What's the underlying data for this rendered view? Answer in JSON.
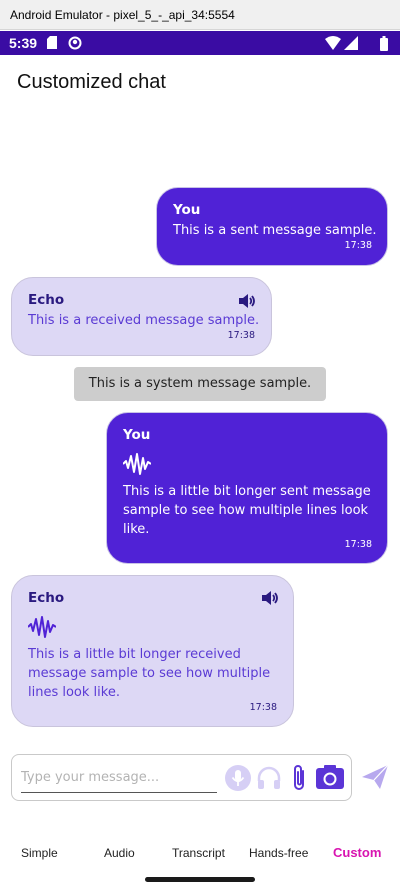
{
  "window": {
    "title": "Android Emulator - pixel_5_-_api_34:5554"
  },
  "status_bar": {
    "time": "5:39"
  },
  "page": {
    "title": "Customized chat"
  },
  "messages": [
    {
      "kind": "sent",
      "sender": "You",
      "text": "This is a sent message sample.",
      "time": "17:38"
    },
    {
      "kind": "received",
      "sender": "Echo",
      "text": "This is a received message sample.",
      "time": "17:38",
      "icon": "speaker-icon"
    },
    {
      "kind": "system",
      "text": "This is a system message sample."
    },
    {
      "kind": "sent",
      "sender": "You",
      "icon": "audio-wave-icon",
      "lines": [
        "This is a little bit longer sent message",
        "sample to see how multiple lines look",
        "like."
      ],
      "time": "17:38"
    },
    {
      "kind": "received",
      "sender": "Echo",
      "icon": "speaker-icon",
      "audio_icon": "audio-wave-icon",
      "lines": [
        "This is a little bit longer received",
        "message sample to see how multiple",
        "lines look like."
      ],
      "time": "17:38"
    }
  ],
  "composer": {
    "placeholder": "Type your message...",
    "icons": [
      "microphone-icon",
      "headphones-icon",
      "paperclip-icon",
      "camera-icon",
      "send-icon"
    ]
  },
  "tabs": [
    {
      "label": "Simple"
    },
    {
      "label": "Audio"
    },
    {
      "label": "Transcript"
    },
    {
      "label": "Hands-free"
    },
    {
      "label": "Custom",
      "active": true
    }
  ],
  "colors": {
    "status_bar": "#3a0ca3",
    "sent_bubble": "#5022d6",
    "received_bubble": "#ddd8f5",
    "system_bubble": "#cdcdcd",
    "active_tab": "#d814b0",
    "icon_accent": "#5b35d6"
  }
}
